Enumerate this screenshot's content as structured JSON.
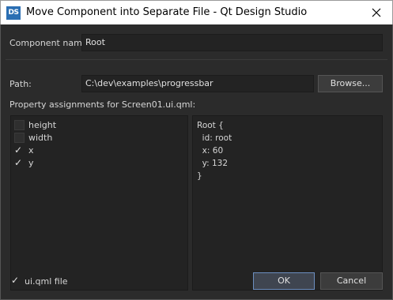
{
  "window": {
    "icon_text": "DS",
    "title": "Move Component into Separate File - Qt Design Studio"
  },
  "component_name": {
    "label": "Component name:",
    "value": "Root"
  },
  "path": {
    "label": "Path:",
    "value": "C:\\dev\\examples\\progressbar",
    "browse_label": "Browse..."
  },
  "property_section": {
    "label": "Property assignments for Screen01.ui.qml:",
    "items": [
      {
        "label": "height",
        "checked": false
      },
      {
        "label": "width",
        "checked": false
      },
      {
        "label": "x",
        "checked": true
      },
      {
        "label": "y",
        "checked": true
      }
    ]
  },
  "preview": {
    "lines": [
      "Root {",
      "  id: root",
      "  x: 60",
      "  y: 132",
      "}"
    ]
  },
  "footer": {
    "uiqml_label": "ui.qml file",
    "uiqml_checked": true,
    "ok_label": "OK",
    "cancel_label": "Cancel"
  },
  "check_glyph": "✓"
}
